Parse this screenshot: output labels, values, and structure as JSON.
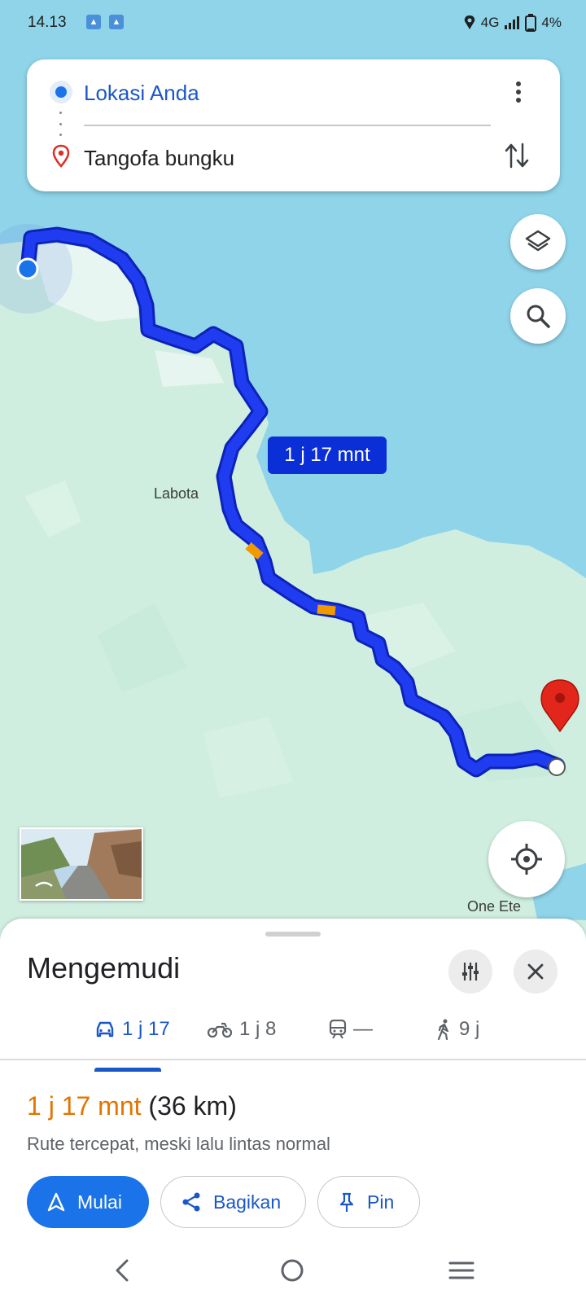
{
  "status_bar": {
    "time": "14.13",
    "network": "4G",
    "battery": "4%"
  },
  "route": {
    "origin": "Lokasi Anda",
    "destination": "Tangofa bungku"
  },
  "map": {
    "eta_label": "1 j 17 mnt",
    "place_labels": [
      "Labota",
      "One Ete"
    ]
  },
  "sheet": {
    "title": "Mengemudi",
    "tabs": [
      {
        "mode": "car-icon",
        "label": "1 j 17"
      },
      {
        "mode": "motorcycle-icon",
        "label": "1 j 8"
      },
      {
        "mode": "train-icon",
        "label": "—"
      },
      {
        "mode": "walk-icon",
        "label": "9 j"
      }
    ],
    "duration": "1 j 17 mnt",
    "distance": "(36 km)",
    "description": "Rute tercepat, meski lalu lintas normal",
    "buttons": {
      "start": "Mulai",
      "share": "Bagikan",
      "pin": "Pin"
    }
  },
  "colors": {
    "accent": "#1a73e8",
    "route": "#1530e0",
    "traffic": "#f29900",
    "duration": "#e37400",
    "water": "#8fd4e9",
    "land": "#cfeee0"
  }
}
